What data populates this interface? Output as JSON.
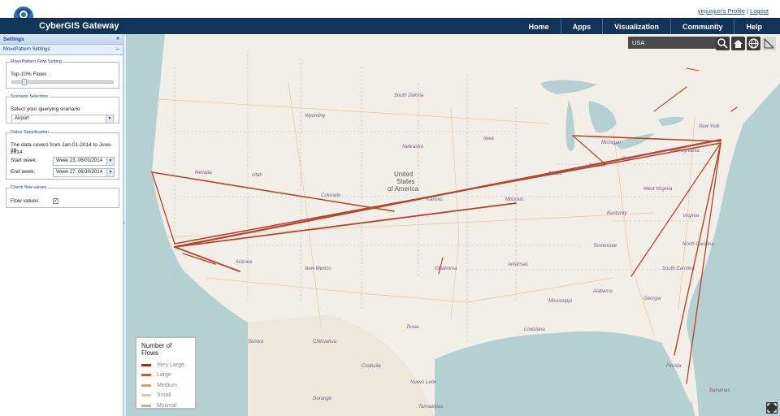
{
  "header": {
    "brand": "CyberGIS Gateway",
    "profile_link": "yinjunjun's Profile",
    "separator": "|",
    "logout_link": "Logout",
    "nav": [
      "Home",
      "Apps",
      "Visualization",
      "Community",
      "Help"
    ]
  },
  "sidebar": {
    "settings_title": "Settings",
    "settings_collapse": "«",
    "panel_title": "MovePattern Settings",
    "panel_collapse": "−",
    "flow_setting": {
      "legend": "MovePattern Flow Setting",
      "label": "Top-10% Flows",
      "slider_value_percent": 10
    },
    "scenario": {
      "legend": "Scenario Selection",
      "label": "Select your querying scenario",
      "value": "Airport"
    },
    "dates": {
      "legend": "Dates Specification",
      "coverage_line1": "The data covers from Jan-01-2014 to June-30-",
      "coverage_line2": "2014",
      "start_label": "Start week:",
      "start_value": "Week 23, 06/01/2014",
      "end_label": "End week:",
      "end_value": "Week 27, 06/30/2014"
    },
    "check_flow": {
      "legend": "Check flow values",
      "label": "Flow values:",
      "checked_mark": "✓"
    }
  },
  "map": {
    "search_value": "USA",
    "tool_icons": [
      "search-icon",
      "home-icon",
      "globe-icon",
      "measure-icon"
    ],
    "labels": {
      "states": [
        "South Dakota",
        "Wyoming",
        "Nebraska",
        "Utah",
        "Colorado",
        "Kansas",
        "Missouri",
        "Iowa",
        "Illinois",
        "Indiana",
        "Ohio",
        "Michigan",
        "Kentucky",
        "Tennessee",
        "Arkansas",
        "Oklahoma",
        "Texas",
        "New Mexico",
        "Arizona",
        "Nevada",
        "Mississippi",
        "Alabama",
        "Georgia",
        "South Carolina",
        "North Carolina",
        "Virginia",
        "West Virginia",
        "Pennsylvania",
        "New York",
        "Louisiana",
        "Florida",
        "Chihuahua",
        "Sonora",
        "Coahuila",
        "Nuevo León",
        "Durango",
        "Tamaulipas",
        "Bahamas"
      ],
      "country_lines": [
        "United",
        "States",
        "of America"
      ]
    },
    "legend": {
      "title": "Number of Flows",
      "items": [
        {
          "label": "Very Large",
          "color": "#a02c1c"
        },
        {
          "label": "Large",
          "color": "#d45a2a"
        },
        {
          "label": "Medium",
          "color": "#e89a5a"
        },
        {
          "label": "Small",
          "color": "#f0c8a0"
        },
        {
          "label": "Minimal",
          "color": "#a8b89a"
        }
      ]
    },
    "flow_color": "#b4442a"
  }
}
